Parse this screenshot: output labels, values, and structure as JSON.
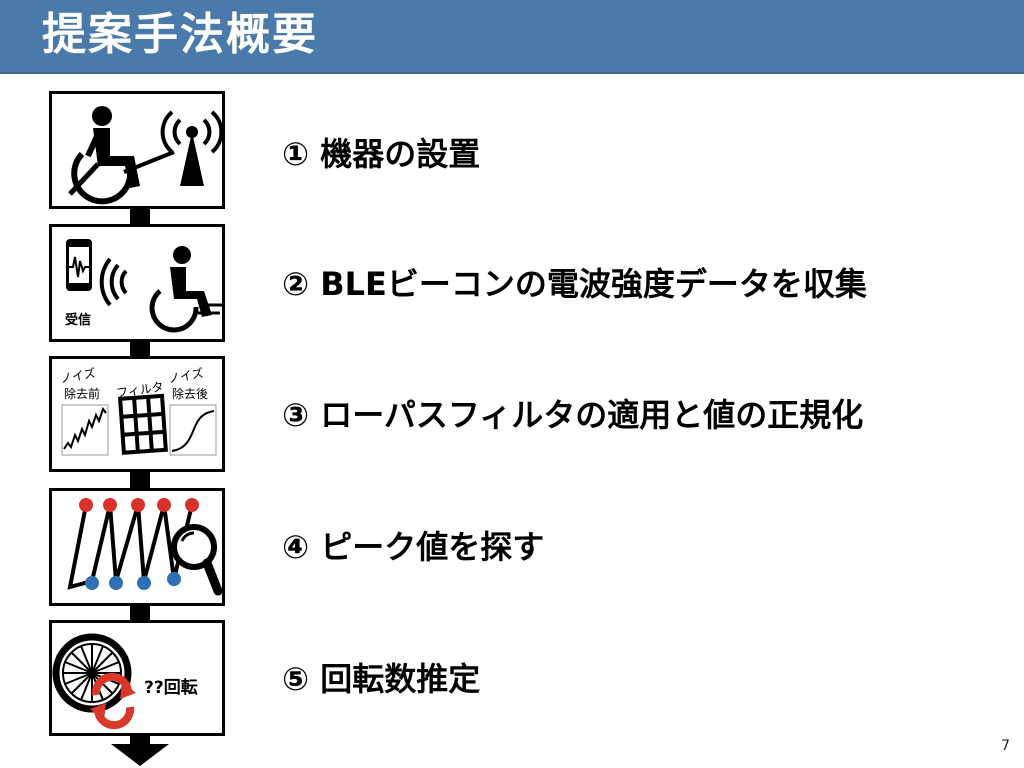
{
  "header": {
    "title": "提案手法概要"
  },
  "steps": [
    {
      "label": "① 機器の設置",
      "icon": "wheelchair-antenna-icon"
    },
    {
      "label": "② BLEビーコンの電波強度データを収集",
      "icon": "phone-signal-wheelchair-icon"
    },
    {
      "label": "③ ローパスフィルタの適用と値の正規化",
      "icon": "lowpass-filter-icon"
    },
    {
      "label": "④ ピーク値を探す",
      "icon": "peak-search-icon"
    },
    {
      "label": "⑤ 回転数推定",
      "icon": "wheel-rotation-icon"
    }
  ],
  "icon_text": {
    "receive": "受信",
    "noise_before_1": "ノイズ",
    "noise_before_2": "除去前",
    "filter": "フィルタ",
    "noise_after_1": "ノイズ",
    "noise_after_2": "除去後",
    "rotations": "??回転"
  },
  "colors": {
    "header": "#4a7aaa",
    "peak_red": "#d9312b",
    "valley_blue": "#2f6fb5",
    "rotate_red": "#d9372a"
  },
  "page": {
    "number": "7"
  }
}
